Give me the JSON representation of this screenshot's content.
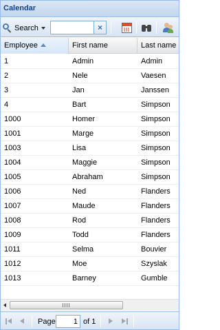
{
  "panel": {
    "title": "Calendar"
  },
  "toolbar": {
    "search_label": "Search",
    "search_value": "",
    "clear_glyph": "×",
    "icons": [
      "calendar-icon",
      "binoculars-icon",
      "users-icon"
    ]
  },
  "grid": {
    "columns": [
      {
        "label": "Employee",
        "sorted": "asc"
      },
      {
        "label": "First name"
      },
      {
        "label": "Last name"
      }
    ],
    "rows": [
      [
        "1",
        "Admin",
        "Admin"
      ],
      [
        "2",
        "Nele",
        "Vaesen"
      ],
      [
        "3",
        "Jan",
        "Janssen"
      ],
      [
        "4",
        "Bart",
        "Simpson"
      ],
      [
        "1000",
        "Homer",
        "Simpson"
      ],
      [
        "1001",
        "Marge",
        "Simpson"
      ],
      [
        "1003",
        "Lisa",
        "Simpson"
      ],
      [
        "1004",
        "Maggie",
        "Simpson"
      ],
      [
        "1005",
        "Abraham",
        "Simpson"
      ],
      [
        "1006",
        "Ned",
        "Flanders"
      ],
      [
        "1007",
        "Maude",
        "Flanders"
      ],
      [
        "1008",
        "Rod",
        "Flanders"
      ],
      [
        "1009",
        "Todd",
        "Flanders"
      ],
      [
        "1011",
        "Selma",
        "Bouvier"
      ],
      [
        "1012",
        "Moe",
        "Szyslak"
      ],
      [
        "1013",
        "Barney",
        "Gumble"
      ]
    ]
  },
  "pager": {
    "page_label": "Page",
    "page_value": "1",
    "of_label": "of 1"
  }
}
